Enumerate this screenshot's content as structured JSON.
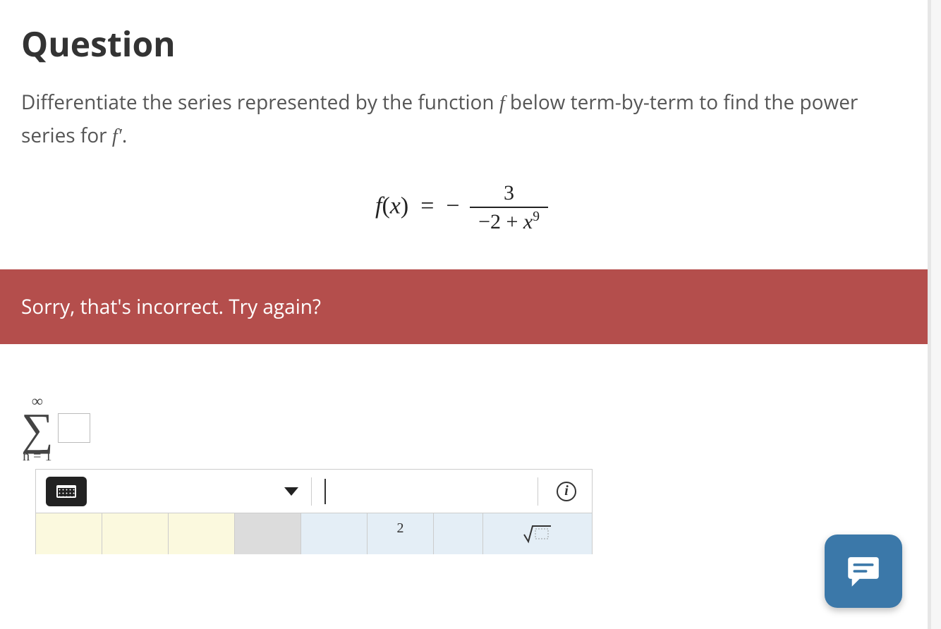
{
  "heading": "Question",
  "prompt_pre": "Differentiate the series represented by the function ",
  "prompt_mid": " below term-by-term to find the power series for ",
  "prompt_fprime": "f′",
  "prompt_end": ".",
  "formula": {
    "lhs": "f(x) = −",
    "num": "3",
    "den_pre": "−2 + x",
    "den_exp": "9"
  },
  "feedback": "Sorry, that's incorrect. Try again?",
  "sigma": {
    "top": "∞",
    "bottom": "n = 1"
  },
  "info_icon_label": "i",
  "keypad": {
    "partial2": "2"
  },
  "colors": {
    "feedback_bg": "#b44e4c",
    "chat_bg": "#3b78a9"
  }
}
